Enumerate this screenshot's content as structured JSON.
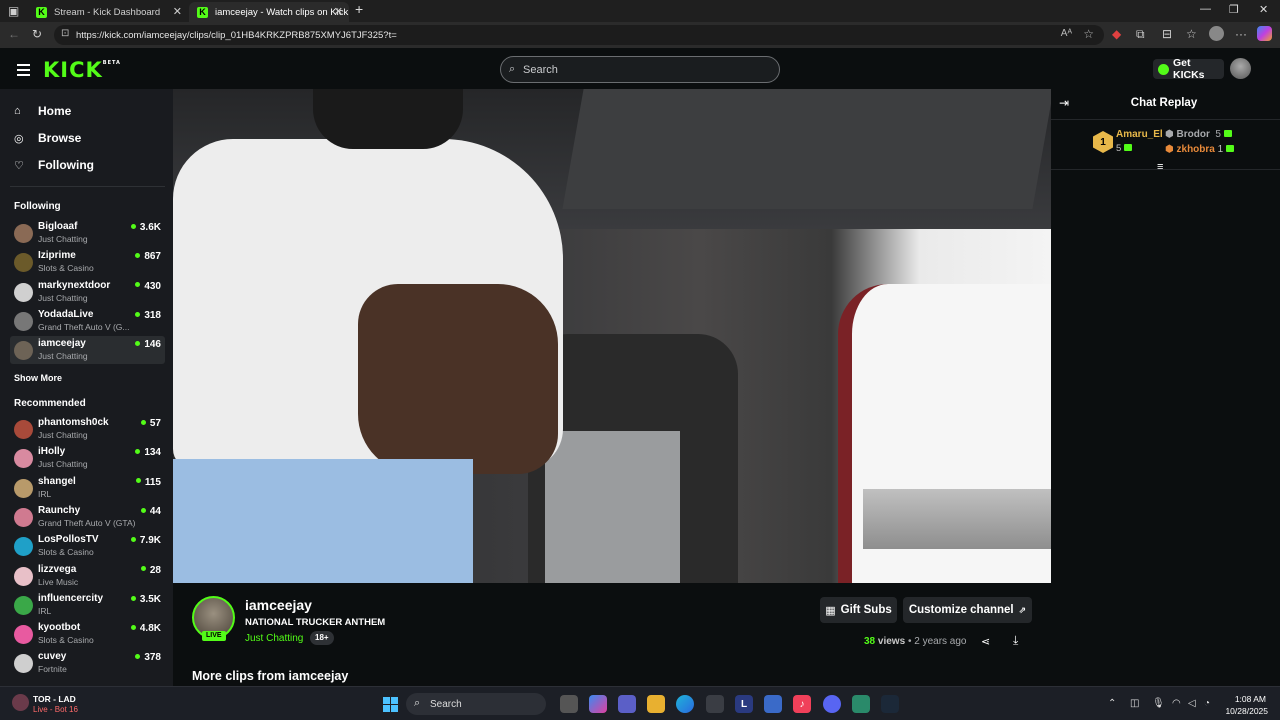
{
  "browser": {
    "tabs": [
      {
        "title": "Stream - Kick Dashboard"
      },
      {
        "title": "iamceejay - Watch clips on Kick"
      }
    ],
    "url": "https://kick.com/iamceejay/clips/clip_01HB4KRKZPRB875XMYJ6TJF325?t="
  },
  "header": {
    "logo": "KICK",
    "logo_badge": "BETA",
    "search_placeholder": "Search",
    "get_kicks_label": "Get KICKs"
  },
  "sidebar": {
    "nav": [
      {
        "label": "Home",
        "icon": "home-icon"
      },
      {
        "label": "Browse",
        "icon": "compass-icon"
      },
      {
        "label": "Following",
        "icon": "heart-icon"
      }
    ],
    "following_heading": "Following",
    "following": [
      {
        "name": "Bigloaaf",
        "category": "Just Chatting",
        "viewers": "3.6K",
        "avatar_color": "#8a6a55"
      },
      {
        "name": "Iziprime",
        "category": "Slots & Casino",
        "viewers": "867",
        "avatar_color": "#6b5a2a"
      },
      {
        "name": "markynextdoor",
        "category": "Just Chatting",
        "viewers": "430",
        "avatar_color": "#d0d0d0"
      },
      {
        "name": "YodadaLive",
        "category": "Grand Theft Auto V (G...",
        "viewers": "318",
        "avatar_color": "#777"
      },
      {
        "name": "iamceejay",
        "category": "Just Chatting",
        "viewers": "146",
        "avatar_color": "#6d6356"
      }
    ],
    "show_more": "Show More",
    "recommended_heading": "Recommended",
    "recommended": [
      {
        "name": "phantomsh0ck",
        "category": "Just Chatting",
        "viewers": "57",
        "avatar_color": "#a84a3a"
      },
      {
        "name": "iHolly",
        "category": "Just Chatting",
        "viewers": "134",
        "avatar_color": "#d88aa0"
      },
      {
        "name": "shangel",
        "category": "IRL",
        "viewers": "115",
        "avatar_color": "#b89a6a"
      },
      {
        "name": "Raunchy",
        "category": "Grand Theft Auto V (GTA)",
        "viewers": "44",
        "avatar_color": "#d07a90"
      },
      {
        "name": "LosPollosTV",
        "category": "Slots & Casino",
        "viewers": "7.9K",
        "avatar_color": "#1fa0c8"
      },
      {
        "name": "lizzvega",
        "category": "Live Music",
        "viewers": "28",
        "avatar_color": "#e8c0c8"
      },
      {
        "name": "influencercity",
        "category": "IRL",
        "viewers": "3.5K",
        "avatar_color": "#3aa848"
      },
      {
        "name": "kyootbot",
        "category": "Slots & Casino",
        "viewers": "4.8K",
        "avatar_color": "#e85aa0"
      },
      {
        "name": "cuvey",
        "category": "Fortnite",
        "viewers": "378",
        "avatar_color": "#cfcfcf"
      }
    ]
  },
  "chat": {
    "title": "Chat Replay",
    "leaderboard": [
      {
        "rank": "1",
        "name": "Amaru_El",
        "count": "5",
        "color": "#e8b84a"
      },
      {
        "name": "Brodor",
        "count": "5",
        "color": "#a8aaad"
      },
      {
        "name": "zkhobra",
        "count": "1",
        "color": "#e88a3a"
      }
    ]
  },
  "clip": {
    "channel": "iamceejay",
    "title": "NATIONAL TRUCKER ANTHEM",
    "category": "Just Chatting",
    "age_badge": "18+",
    "live_badge": "LIVE",
    "views": "38",
    "views_label": "views",
    "separator": "•",
    "time_ago": "2 years ago",
    "gift_subs_label": "Gift Subs",
    "customize_label": "Customize channel",
    "more_clips": "More clips from iamceejay"
  },
  "taskbar": {
    "weather_title": "TOR - LAD",
    "weather_sub": "Live - Bot 16",
    "search_label": "Search",
    "time": "1:08 AM",
    "date": "10/28/2025"
  },
  "colors": {
    "accent": "#53fc18",
    "sidebar_bg": "#191b1f",
    "page_bg": "#0b0e0f"
  }
}
